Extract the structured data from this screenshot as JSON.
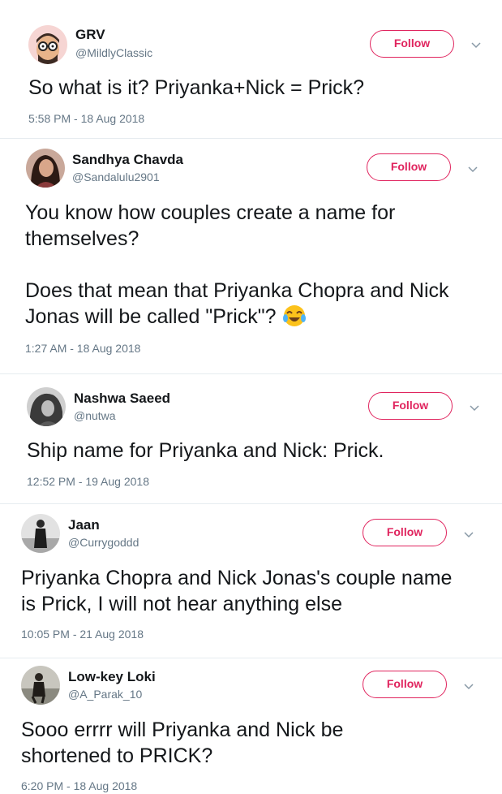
{
  "follow_label": "Follow",
  "tweets": [
    {
      "name": "GRV",
      "handle": "@MildlyClassic",
      "text": "So what is it? Priyanka+Nick = Prick?",
      "timestamp": "5:58 PM - 18 Aug 2018",
      "avatar": "cartoon-glasses-avatar"
    },
    {
      "name": "Sandhya Chavda",
      "handle": "@Sandalulu2901",
      "text_1": "You know how couples create a name for themselves?",
      "text_2": "Does that mean that Priyanka Chopra and Nick Jonas will be called \"Prick\"?",
      "emoji": "face-with-tears-of-joy",
      "timestamp": "1:27 AM - 18 Aug 2018",
      "avatar": "woman-photo-avatar"
    },
    {
      "name": "Nashwa Saeed",
      "handle": "@nutwa",
      "text": "Ship name for Priyanka and Nick: Prick.",
      "timestamp": "12:52 PM - 19 Aug 2018",
      "avatar": "grayscale-photo-avatar"
    },
    {
      "name": "Jaan",
      "handle": "@Currygoddd",
      "text": "Priyanka Chopra and Nick Jonas's couple name is Prick, I will not hear anything else",
      "timestamp": "10:05 PM - 21 Aug 2018",
      "avatar": "man-standing-photo-avatar"
    },
    {
      "name": "Low-key Loki",
      "handle": "@A_Parak_10",
      "text": "Sooo errrr will Priyanka and Nick be shortened to PRICK?",
      "timestamp": "6:20 PM - 18 Aug 2018",
      "avatar": "man-outdoors-photo-avatar"
    }
  ],
  "colors": {
    "follow_accent": "#e0245e",
    "name": "#14171a",
    "muted": "#657786",
    "divider": "#e6ecf0"
  }
}
